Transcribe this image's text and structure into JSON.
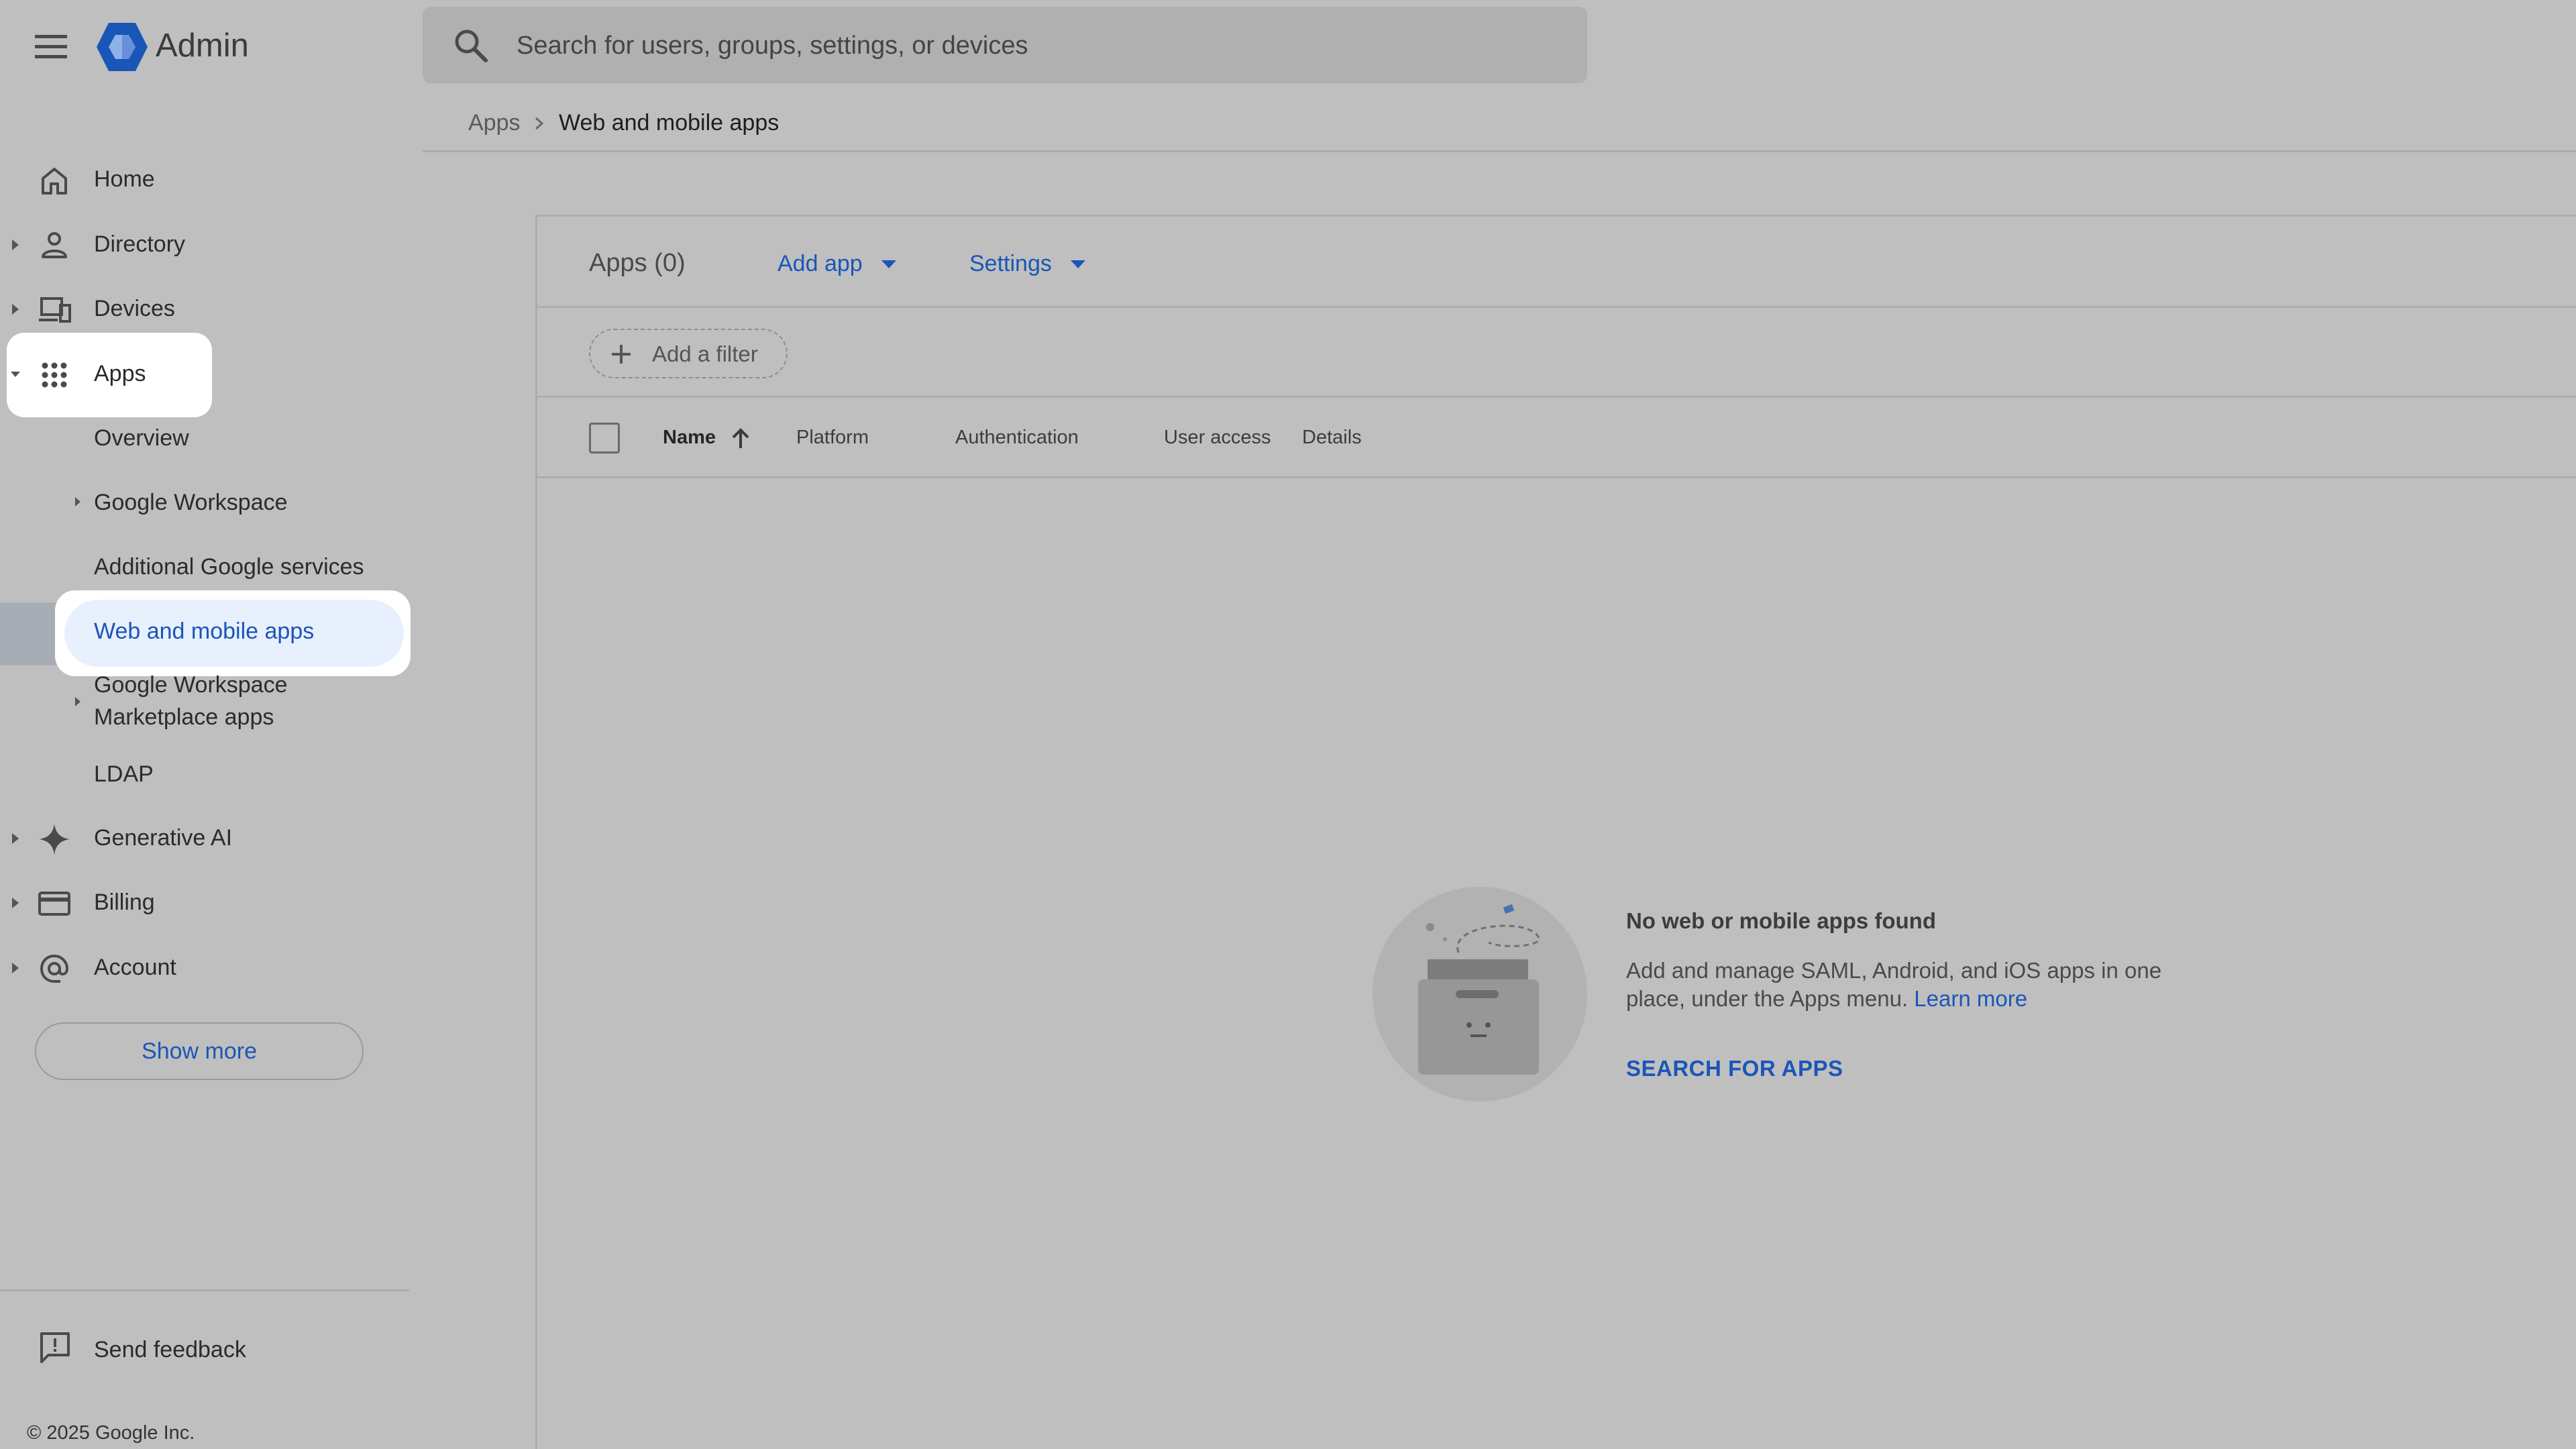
{
  "header": {
    "app_title": "Admin",
    "search_placeholder": "Search for users, groups, settings, or devices",
    "menu_icon": "hamburger-menu-icon",
    "logo_color": "#1a56b8"
  },
  "breadcrumb": {
    "root": "Apps",
    "current": "Web and mobile apps"
  },
  "sidebar": {
    "items": [
      {
        "label": "Home",
        "icon": "home-icon"
      },
      {
        "label": "Directory",
        "icon": "person-icon"
      },
      {
        "label": "Devices",
        "icon": "devices-icon"
      },
      {
        "label": "Apps",
        "icon": "apps-grid-icon",
        "expanded": true
      },
      {
        "label": "Generative AI",
        "icon": "sparkle-icon"
      },
      {
        "label": "Billing",
        "icon": "credit-card-icon"
      },
      {
        "label": "Account",
        "icon": "at-sign-icon"
      }
    ],
    "apps_children": [
      {
        "label": "Overview"
      },
      {
        "label": "Google Workspace"
      },
      {
        "label": "Additional Google services"
      },
      {
        "label": "Web and mobile apps",
        "selected": true
      },
      {
        "label_line1": "Google Workspace",
        "label_line2": "Marketplace apps"
      },
      {
        "label": "LDAP"
      }
    ],
    "show_more": "Show more",
    "send_feedback": "Send feedback",
    "copyright": "© 2025 Google Inc."
  },
  "main": {
    "toolbar": {
      "title": "Apps (0)",
      "add_app": "Add app",
      "settings": "Settings"
    },
    "filter": {
      "add_filter": "Add a filter"
    },
    "table": {
      "columns": [
        "Name",
        "Platform",
        "Authentication",
        "User access",
        "Details"
      ],
      "sort_column": "Name",
      "sort_direction": "ascending"
    },
    "empty_state": {
      "title": "No web or mobile apps found",
      "description": "Add and manage SAML, Android, and iOS apps in one place, under the Apps menu.",
      "learn_more": "Learn more",
      "action": "SEARCH FOR APPS"
    }
  },
  "colors": {
    "accent": "#1a56b8",
    "background": "#bfbfbf",
    "selected_bg": "#e8f0fe"
  }
}
